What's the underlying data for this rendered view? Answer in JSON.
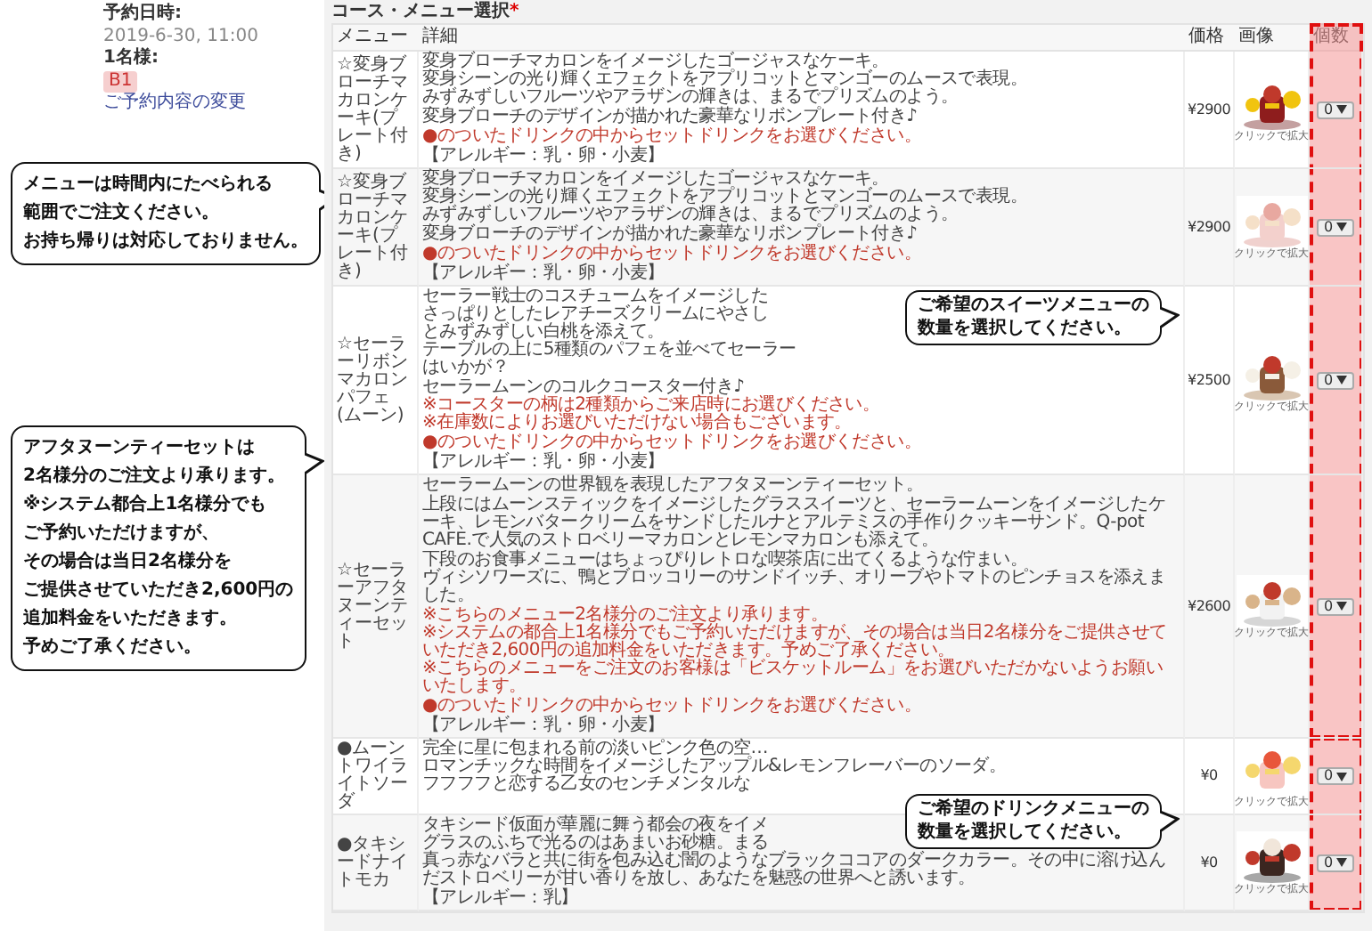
{
  "reservation": {
    "date_label": "予約日時:",
    "date": "2019-6-30, 11:00",
    "party_label": "1名様:",
    "badge": "B1",
    "change_link": "ご予約内容の変更"
  },
  "side_notes": [
    {
      "lines": [
        "メニューは時間内にたべられる",
        "範囲でご注文ください。",
        "お持ち帰りは対応しておりません。"
      ]
    },
    {
      "lines": [
        "アフタヌーンティーセットは",
        "2名様分のご注文より承ります。",
        "※システム都合上1名様分でも",
        "ご予約いただけますが、",
        "その場合は当日2名様分を",
        "ご提供させていただき2,600円の",
        "追加料金をいただきます。",
        "予めご了承ください。"
      ]
    }
  ],
  "section": {
    "title": "コース・メニュー選択",
    "required_mark": "*"
  },
  "columns": [
    "メニュー",
    "詳細",
    "価格",
    "画像",
    "個数"
  ],
  "rows": [
    {
      "kind": "sweets",
      "menu": "☆変身ブローチマカロンケーキ(プレート付き)",
      "price": "¥2900",
      "image_caption": "クリックで拡大",
      "quantity": "0",
      "paragraphs": [
        [
          {
            "kind": "plain",
            "text": "変身ブローチマカロンをイメージしたゴージャスなケーキ。"
          },
          {
            "kind": "plain",
            "text": "変身シーンの光り輝くエフェクトをアプリコットとマンゴーのムースで表現。"
          },
          {
            "kind": "plain",
            "text": "みずみずしいフルーツやアラザンの輝きは、まるでプリズムのよう。"
          }
        ],
        [
          {
            "kind": "plain",
            "text": "変身ブローチのデザインが描かれた豪華なリボンプレート付き♪"
          }
        ],
        [
          {
            "kind": "notice",
            "text": "●のついたドリンクの中からセットドリンクをお選びください。"
          }
        ],
        [
          {
            "kind": "plain",
            "text": "【アレルギー：乳・卵・小麦】"
          }
        ]
      ]
    },
    {
      "kind": "sweets",
      "menu": "☆変身ブローチマカロンケーキ(プレート付き)",
      "price": "¥2900",
      "image_caption": "クリックで拡大",
      "quantity": "0",
      "paragraphs": [
        [
          {
            "kind": "plain",
            "text": "変身ブローチマカロンをイメージしたゴージャスなケーキ。"
          },
          {
            "kind": "plain",
            "text": "変身シーンの光り輝くエフェクトをアプリコットとマンゴーのムースで表現。"
          },
          {
            "kind": "plain",
            "text": "みずみずしいフルーツやアラザンの輝きは、まるでプリズムのよう。"
          }
        ],
        [
          {
            "kind": "plain",
            "text": "変身ブローチのデザインが描かれた豪華なリボンプレート付き♪"
          }
        ],
        [
          {
            "kind": "notice",
            "text": "●のついたドリンクの中からセットドリンクをお選びください。"
          }
        ],
        [
          {
            "kind": "plain",
            "text": "【アレルギー：乳・卵・小麦】"
          }
        ]
      ]
    },
    {
      "kind": "sweets",
      "menu": "☆セーラーリボンマカロンパフェ(ムーン)",
      "price": "¥2500",
      "image_caption": "クリックで拡大",
      "quantity": "0",
      "callout": {
        "lines": [
          "ご希望のスイーツメニューの",
          "数量を選択してください。"
        ]
      },
      "paragraphs": [
        [
          {
            "kind": "plain",
            "text": "セーラー戦士のコスチュームをイメージした"
          },
          {
            "kind": "plain",
            "text": "さっぱりとしたレアチーズクリームにやさし"
          },
          {
            "kind": "plain",
            "text": "とみずみずしい白桃を添えて。"
          },
          {
            "kind": "plain",
            "text": "テーブルの上に5種類のパフェを並べてセーラー"
          },
          {
            "kind": "plain",
            "text": "はいかが？"
          }
        ],
        [
          {
            "kind": "plain",
            "text": "セーラームーンのコルクコースター付き♪"
          },
          {
            "kind": "notice",
            "text": "※コースターの柄は2種類からご来店時にお選びください。"
          },
          {
            "kind": "notice",
            "text": "※在庫数によりお選びいただけない場合もございます。"
          }
        ],
        [
          {
            "kind": "notice",
            "text": "●のついたドリンクの中からセットドリンクをお選びください。"
          }
        ],
        [
          {
            "kind": "plain",
            "text": "【アレルギー：乳・卵・小麦】"
          }
        ]
      ]
    },
    {
      "kind": "sweets",
      "menu": "☆セーラーアフタヌーンティーセット",
      "price": "¥2600",
      "image_caption": "クリックで拡大",
      "quantity": "0",
      "paragraphs": [
        [
          {
            "kind": "plain",
            "text": "セーラームーンの世界観を表現したアフタヌーンティーセット。"
          }
        ],
        [
          {
            "kind": "plain",
            "text": "上段にはムーンスティックをイメージしたグラススイーツと、セーラームーンをイメージしたケーキ、レモンバタークリームをサンドしたルナとアルテミスの手作りクッキーサンド。Q-pot CAFE.で人気のストロベリーマカロンとレモンマカロンも添えて。"
          }
        ],
        [
          {
            "kind": "plain",
            "text": "下段のお食事メニューはちょっぴりレトロな喫茶店に出てくるような佇まい。"
          },
          {
            "kind": "plain",
            "text": "ヴィシソワーズに、鴨とブロッコリーのサンドイッチ、オリーブやトマトのピンチョスを添えました。"
          }
        ],
        [
          {
            "kind": "notice",
            "text": "※こちらのメニュー2名様分のご注文より承ります。"
          },
          {
            "kind": "notice",
            "text": "※システムの都合上1名様分でもご予約いただけますが、その場合は当日2名様分をご提供させていただき2,600円の追加料金をいただきます。予めご了承ください。"
          },
          {
            "kind": "notice",
            "text": "※こちらのメニューをご注文のお客様は「ビスケットルーム」をお選びいただかないようお願いいたします。"
          }
        ],
        [
          {
            "kind": "notice",
            "text": "●のついたドリンクの中からセットドリンクをお選びください。"
          }
        ],
        [
          {
            "kind": "plain",
            "text": "【アレルギー：乳・卵・小麦】"
          }
        ]
      ]
    },
    {
      "kind": "drink",
      "menu": "●ムーントワイライトソーダ",
      "price": "¥0",
      "image_caption": "クリックで拡大",
      "quantity": "0",
      "paragraphs": [
        [
          {
            "kind": "plain",
            "text": "完全に星に包まれる前の淡いピンク色の空…"
          },
          {
            "kind": "plain",
            "text": "ロマンチックな時間をイメージしたアップル&レモンフレーバーのソーダ。"
          },
          {
            "kind": "plain",
            "text": "フフフフと恋する乙女のセンチメンタルな"
          }
        ]
      ]
    },
    {
      "kind": "drink",
      "menu": "●タキシードナイトモカ",
      "price": "¥0",
      "image_caption": "クリックで拡大",
      "quantity": "0",
      "callout": {
        "lines": [
          "ご希望のドリンクメニューの",
          "数量を選択してください。"
        ]
      },
      "paragraphs": [
        [
          {
            "kind": "plain",
            "text": "タキシード仮面が華麗に舞う都会の夜をイメ"
          },
          {
            "kind": "plain",
            "text": "グラスのふちで光るのはあまいお砂糖。まる"
          },
          {
            "kind": "plain",
            "text": "真っ赤なバラと共に街を包み込む闇のようなブラックココアのダークカラー。その中に溶け込んだストロベリーが甘い香りを放し、あなたを魅惑の世界へと誘います。"
          }
        ],
        [
          {
            "kind": "plain",
            "text": "【アレルギー：乳】"
          }
        ]
      ]
    }
  ]
}
